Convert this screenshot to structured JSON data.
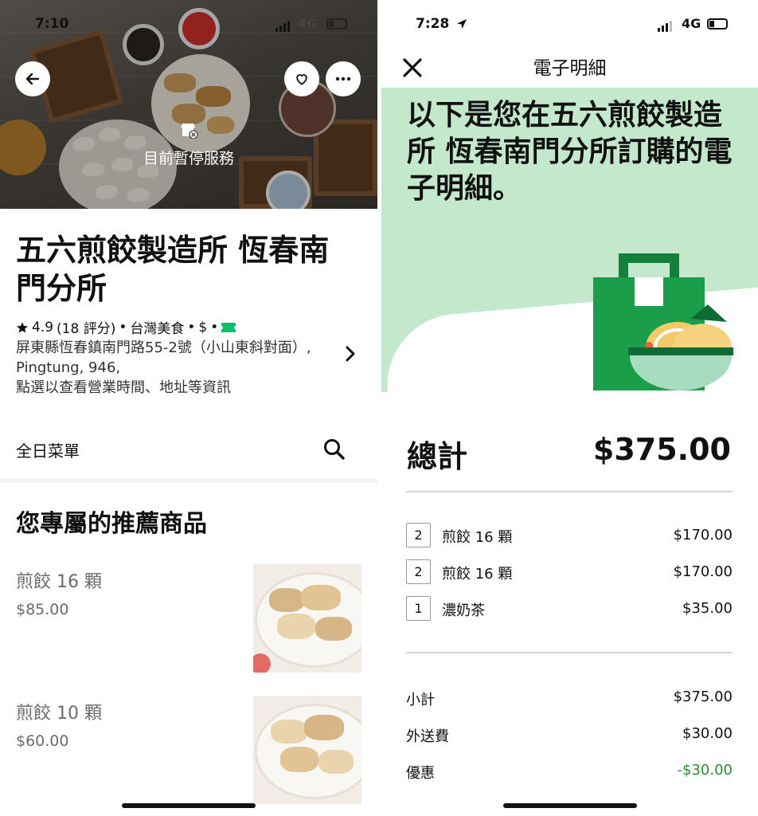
{
  "left": {
    "status": {
      "time": "7:10",
      "network": "4G"
    },
    "hero": {
      "paused_text": "目前暫停服務"
    },
    "store": {
      "name": "五六煎餃製造所 恆春南門分所",
      "rating": "4.9",
      "reviews": "(18 評分)",
      "cuisine": "台灣美食",
      "price_level": "$",
      "address": "屏東縣恆春鎮南門路55-2號（小山東斜對面）, Pingtung, 946,",
      "hint": "點選以查看營業時間、地址等資訊"
    },
    "menu": {
      "label": "全日菜單"
    },
    "recommended": {
      "title": "您專屬的推薦商品",
      "items": [
        {
          "name": "煎餃 16 顆",
          "price": "$85.00"
        },
        {
          "name": "煎餃 10 顆",
          "price": "$60.00"
        }
      ]
    }
  },
  "right": {
    "status": {
      "time": "7:28",
      "network": "4G"
    },
    "header": {
      "title": "電子明細"
    },
    "headline": "以下是您在五六煎餃製造所 恆春南門分所訂購的電子明細。",
    "total": {
      "label": "總計",
      "value": "$375.00"
    },
    "items": [
      {
        "qty": "2",
        "name": "煎餃 16 顆",
        "amount": "$170.00"
      },
      {
        "qty": "2",
        "name": "煎餃 16 顆",
        "amount": "$170.00"
      },
      {
        "qty": "1",
        "name": "濃奶茶",
        "amount": "$35.00"
      }
    ],
    "summary": {
      "subtotal_label": "小計",
      "subtotal_value": "$375.00",
      "delivery_label": "外送費",
      "delivery_value": "$30.00",
      "discount_label": "優惠",
      "discount_value": "-$30.00"
    }
  },
  "colors": {
    "brand_green": "#06C167",
    "receipt_bg": "#c3e8cc",
    "discount_green": "#2e8b34"
  },
  "icons": [
    "back-arrow-icon",
    "heart-icon",
    "more-icon",
    "store-closed-icon",
    "star-icon",
    "uber-one-icon",
    "chevron-right-icon",
    "search-icon",
    "close-icon",
    "location-arrow-icon",
    "battery-icon",
    "cellular-signal-icon",
    "bag-illustration"
  ]
}
